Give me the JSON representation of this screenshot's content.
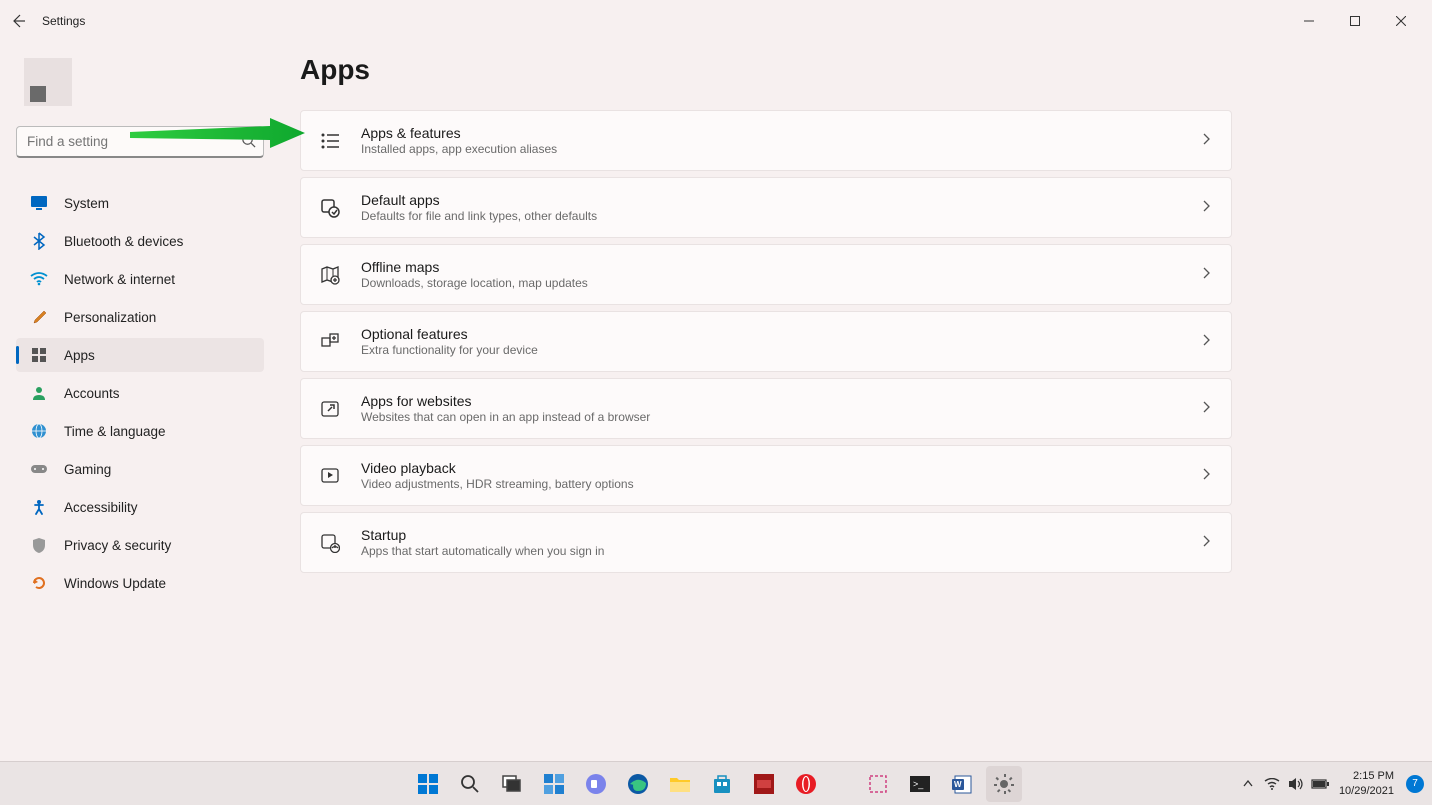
{
  "window": {
    "title": "Settings"
  },
  "search": {
    "placeholder": "Find a setting"
  },
  "nav": {
    "items": [
      {
        "label": "System",
        "icon": "display"
      },
      {
        "label": "Bluetooth & devices",
        "icon": "bluetooth"
      },
      {
        "label": "Network & internet",
        "icon": "wifi"
      },
      {
        "label": "Personalization",
        "icon": "brush"
      },
      {
        "label": "Apps",
        "icon": "grid",
        "active": true
      },
      {
        "label": "Accounts",
        "icon": "user"
      },
      {
        "label": "Time & language",
        "icon": "globe"
      },
      {
        "label": "Gaming",
        "icon": "gamepad"
      },
      {
        "label": "Accessibility",
        "icon": "accessibility"
      },
      {
        "label": "Privacy & security",
        "icon": "shield"
      },
      {
        "label": "Windows Update",
        "icon": "update"
      }
    ]
  },
  "page": {
    "title": "Apps",
    "cards": [
      {
        "title": "Apps & features",
        "subtitle": "Installed apps, app execution aliases"
      },
      {
        "title": "Default apps",
        "subtitle": "Defaults for file and link types, other defaults"
      },
      {
        "title": "Offline maps",
        "subtitle": "Downloads, storage location, map updates"
      },
      {
        "title": "Optional features",
        "subtitle": "Extra functionality for your device"
      },
      {
        "title": "Apps for websites",
        "subtitle": "Websites that can open in an app instead of a browser"
      },
      {
        "title": "Video playback",
        "subtitle": "Video adjustments, HDR streaming, battery options"
      },
      {
        "title": "Startup",
        "subtitle": "Apps that start automatically when you sign in"
      }
    ]
  },
  "taskbar": {
    "time": "2:15 PM",
    "date": "10/29/2021",
    "notif_count": "7"
  }
}
